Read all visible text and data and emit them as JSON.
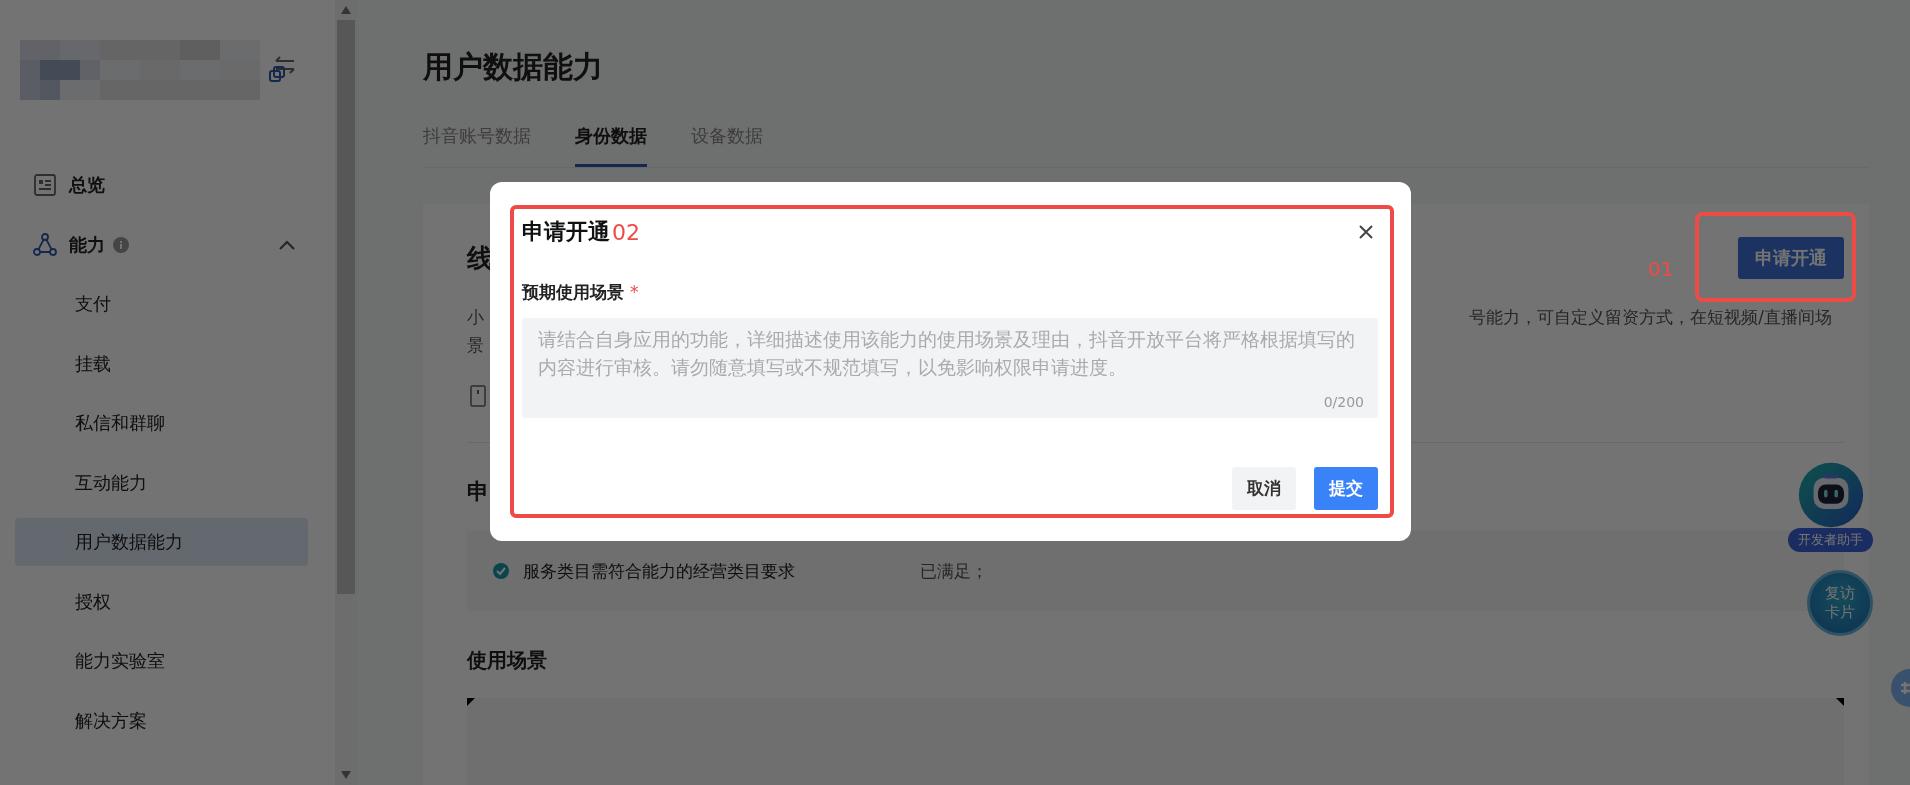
{
  "sidebar": {
    "items": [
      {
        "label": "总览",
        "selected": false
      },
      {
        "label": "能力",
        "selected": false,
        "expanded": true,
        "children": [
          {
            "label": "支付",
            "selected": false
          },
          {
            "label": "挂载",
            "selected": false
          },
          {
            "label": "私信和群聊",
            "selected": false
          },
          {
            "label": "互动能力",
            "selected": false
          },
          {
            "label": "用户数据能力",
            "selected": true
          },
          {
            "label": "授权",
            "selected": false
          },
          {
            "label": "能力实验室",
            "selected": false
          },
          {
            "label": "解决方案",
            "selected": false
          }
        ]
      }
    ]
  },
  "page": {
    "title": "用户数据能力",
    "tabs": [
      {
        "label": "抖音账号数据",
        "selected": false
      },
      {
        "label": "身份数据",
        "selected": true
      },
      {
        "label": "设备数据",
        "selected": false
      }
    ]
  },
  "section": {
    "title_fragment": "线",
    "description_left": [
      "小",
      "景"
    ],
    "description_right": "号能力，可自定义留资方式，在短视频/直播间场",
    "apply_button": "申请开通"
  },
  "requirements": {
    "title_fragment": "申",
    "rows": [
      {
        "text": "服务类目需符合能力的经营类目要求",
        "status": "已满足；",
        "met": true
      }
    ]
  },
  "usage": {
    "title": "使用场景"
  },
  "floating": [
    {
      "kind": "assistant",
      "label": "开发者助手"
    },
    {
      "kind": "card",
      "label": "复访卡片"
    }
  ],
  "annotation": "01",
  "dialog": {
    "title": "申请开通",
    "annotation": "02",
    "field": {
      "label": "预期使用场景",
      "required": true,
      "required_mark": "*",
      "placeholder": "请结合自身应用的功能，详细描述使用该能力的使用场景及理由，抖音开放平台将严格根据填写的内容进行审核。请勿随意填写或不规范填写，以免影响权限申请进度。",
      "counter": "0/200"
    },
    "buttons": [
      {
        "label": "取消",
        "kind": "secondary"
      },
      {
        "label": "提交",
        "kind": "primary"
      }
    ]
  }
}
